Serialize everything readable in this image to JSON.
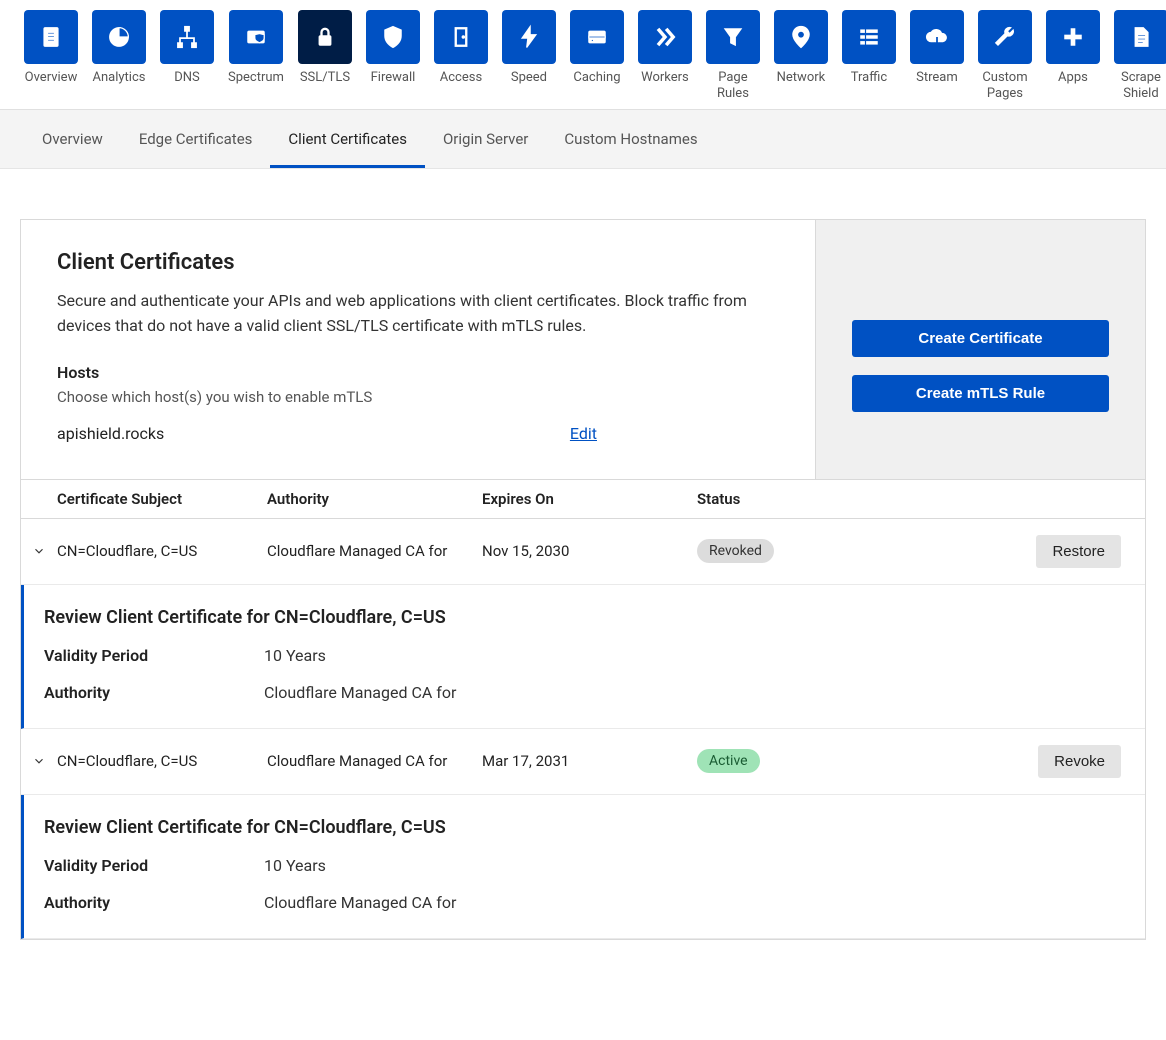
{
  "top_nav": [
    {
      "label": "Overview",
      "icon": "clipboard"
    },
    {
      "label": "Analytics",
      "icon": "pie"
    },
    {
      "label": "DNS",
      "icon": "network"
    },
    {
      "label": "Spectrum",
      "icon": "shield-card"
    },
    {
      "label": "SSL/TLS",
      "icon": "lock",
      "active": true
    },
    {
      "label": "Firewall",
      "icon": "shield"
    },
    {
      "label": "Access",
      "icon": "door"
    },
    {
      "label": "Speed",
      "icon": "bolt"
    },
    {
      "label": "Caching",
      "icon": "server"
    },
    {
      "label": "Workers",
      "icon": "workers"
    },
    {
      "label": "Page\nRules",
      "icon": "funnel"
    },
    {
      "label": "Network",
      "icon": "pin"
    },
    {
      "label": "Traffic",
      "icon": "list"
    },
    {
      "label": "Stream",
      "icon": "cloud"
    },
    {
      "label": "Custom\nPages",
      "icon": "wrench"
    },
    {
      "label": "Apps",
      "icon": "plus"
    },
    {
      "label": "Scrape\nShield",
      "icon": "doc"
    }
  ],
  "subnav": {
    "tabs": [
      "Overview",
      "Edge Certificates",
      "Client Certificates",
      "Origin Server",
      "Custom Hostnames"
    ],
    "active": "Client Certificates"
  },
  "panel": {
    "title": "Client Certificates",
    "description": "Secure and authenticate your APIs and web applications with client certificates. Block traffic from devices that do not have a valid client SSL/TLS certificate with mTLS rules.",
    "hosts_label": "Hosts",
    "hosts_help": "Choose which host(s) you wish to enable mTLS",
    "host_value": "apishield.rocks",
    "edit_label": "Edit",
    "buttons": {
      "create_cert": "Create Certificate",
      "create_rule": "Create mTLS Rule"
    }
  },
  "table": {
    "headers": {
      "subject": "Certificate Subject",
      "authority": "Authority",
      "expires": "Expires On",
      "status": "Status"
    },
    "rows": [
      {
        "subject": "CN=Cloudflare, C=US",
        "authority": "Cloudflare Managed CA for",
        "expires": "Nov 15, 2030",
        "status": "Revoked",
        "status_class": "pill-revoked",
        "action_label": "Restore",
        "detail": {
          "title": "Review Client Certificate for CN=Cloudflare, C=US",
          "validity_label": "Validity Period",
          "validity_value": "10 Years",
          "authority_label": "Authority",
          "authority_value": "Cloudflare Managed CA for"
        }
      },
      {
        "subject": "CN=Cloudflare, C=US",
        "authority": "Cloudflare Managed CA for",
        "expires": "Mar 17, 2031",
        "status": "Active",
        "status_class": "pill-active",
        "action_label": "Revoke",
        "detail": {
          "title": "Review Client Certificate for CN=Cloudflare, C=US",
          "validity_label": "Validity Period",
          "validity_value": "10 Years",
          "authority_label": "Authority",
          "authority_value": "Cloudflare Managed CA for"
        }
      }
    ]
  }
}
